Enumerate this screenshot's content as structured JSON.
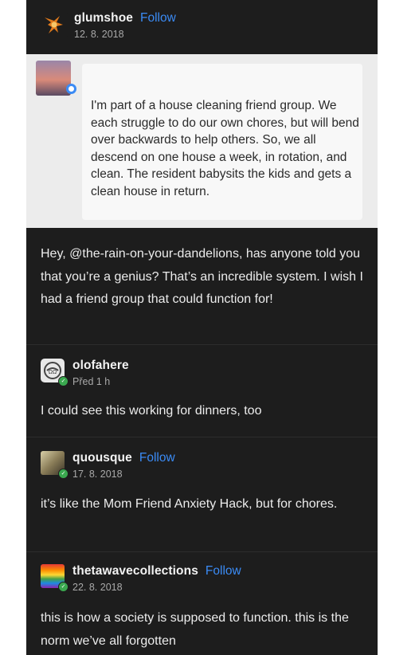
{
  "post": {
    "author": "glumshoe",
    "follow_label": "Follow",
    "date": "12. 8. 2018",
    "quoted": {
      "author": "the-rain-on-your-dandelions",
      "text": "I'm part of a house cleaning friend group. We each struggle to do our own chores, but will bend over backwards to help others. So, we all descend on one house a week, in rotation, and clean. The resident babysits the kids and gets a clean house in return."
    },
    "reply_text": "Hey, @the-rain-on-your-dandelions, has anyone told you that you’re a genius? That’s an incredible system. I wish I had a friend group that could function for!"
  },
  "comments": [
    {
      "author": "olofahere",
      "date": "Před 1 h",
      "text": "I could see this working for dinners, too"
    },
    {
      "author": "quousque",
      "follow_label": "Follow",
      "date": "17. 8. 2018",
      "text": "it’s like the Mom Friend Anxiety Hack, but for chores."
    },
    {
      "author": "thetawavecollections",
      "follow_label": "Follow",
      "date": "22. 8. 2018",
      "text": "this is how a society is supposed to function. this is the norm we’ve all forgotten"
    }
  ],
  "colors": {
    "background": "#1d1d1d",
    "follow": "#3b8bf5",
    "badge": "#3aa84f"
  },
  "icons": [
    "glumshoe-avatar",
    "sunset-avatar",
    "olofahere-avatar",
    "quousque-avatar",
    "rainbow-avatar",
    "check-badge-icon"
  ]
}
